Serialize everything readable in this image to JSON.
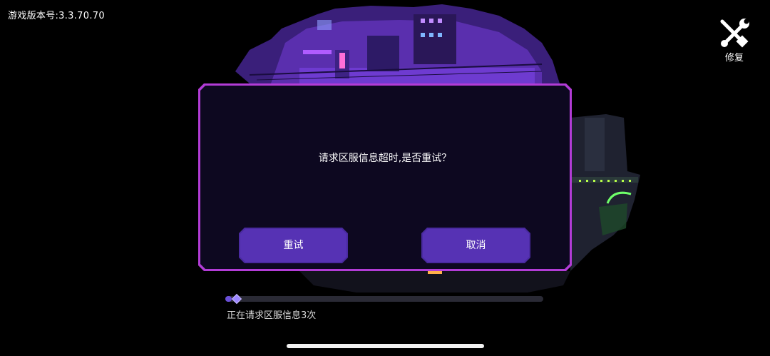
{
  "header": {
    "version_text": "游戏版本号:3.3.70.70"
  },
  "repair": {
    "label": "修复",
    "icon": "wrench-screwdriver-icon"
  },
  "dialog": {
    "message": "请求区服信息超时,是否重试？",
    "retry_label": "重试",
    "cancel_label": "取消"
  },
  "loading": {
    "progress": 0.02,
    "status_text": "正在请求区服信息3次"
  },
  "colors": {
    "accent": "#b23cd6",
    "button": "#4a2aa0",
    "dialog_bg": "#0d0820"
  }
}
